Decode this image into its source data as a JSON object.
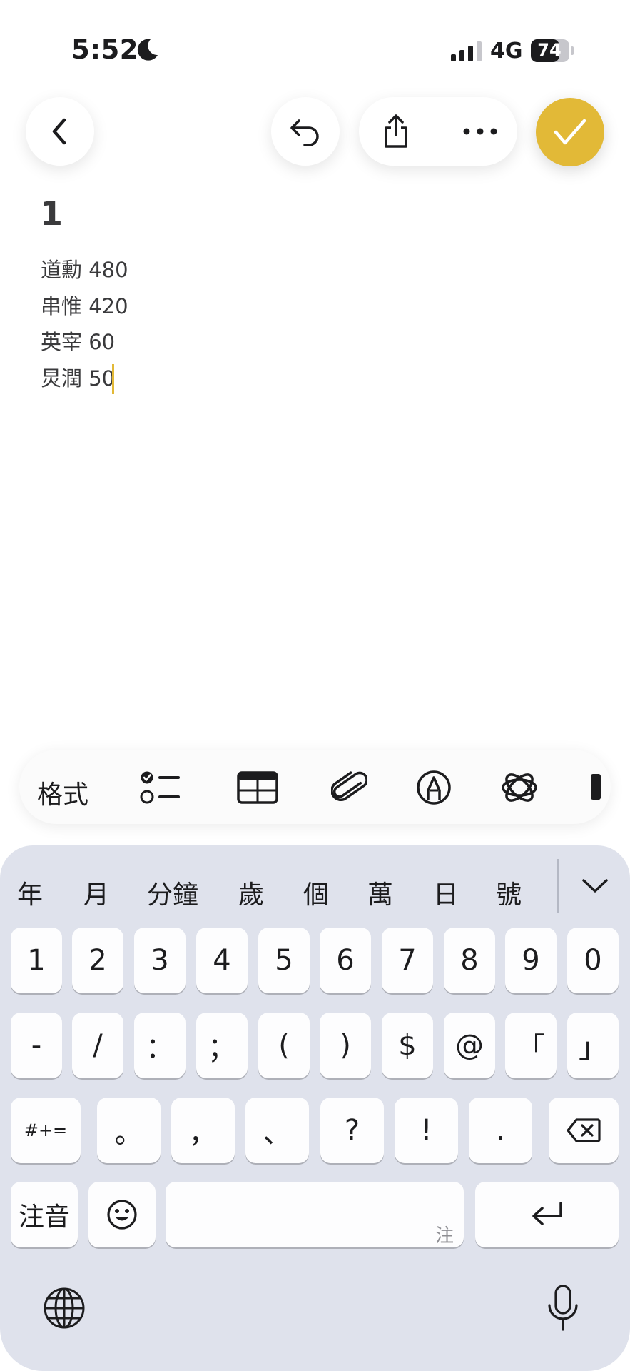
{
  "status": {
    "time": "5:52",
    "network": "4G",
    "battery": "74",
    "moon_icon": "moon-icon",
    "signal_icon": "signal-icon"
  },
  "nav": {
    "back_icon": "chevron-left-icon",
    "undo_icon": "undo-icon",
    "share_icon": "share-icon",
    "more_icon": "more-icon",
    "done_icon": "checkmark-icon",
    "accent": "#e2b937"
  },
  "note": {
    "title": "1",
    "lines": [
      "道勳 480",
      "串惟 420",
      "英宰 60",
      "炅潤 50"
    ]
  },
  "toolbar": {
    "format_label": "格式",
    "icons": [
      "checklist-icon",
      "table-icon",
      "paperclip-icon",
      "markup-pen-icon",
      "apple-intelligence-icon"
    ]
  },
  "keyboard": {
    "candidates": [
      "年",
      "月",
      "分鐘",
      "歲",
      "個",
      "萬",
      "日",
      "號"
    ],
    "row1": [
      "1",
      "2",
      "3",
      "4",
      "5",
      "6",
      "7",
      "8",
      "9",
      "0"
    ],
    "row2": [
      "-",
      "/",
      "：",
      "；",
      "(",
      ")",
      "$",
      "@",
      "「",
      "」"
    ],
    "row3": [
      "#+=",
      "。",
      "，",
      "、",
      "?",
      "!",
      "."
    ],
    "mode_key": "注音",
    "space_hint": "注",
    "background": "#dfe2ec"
  }
}
